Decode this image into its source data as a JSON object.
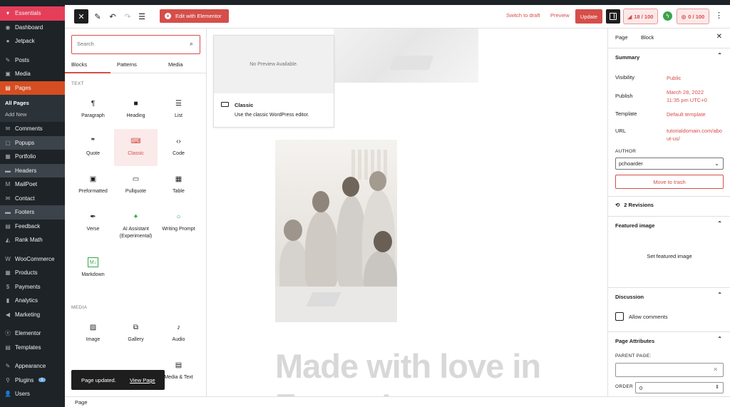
{
  "admin_menu": {
    "items": [
      {
        "label": "Essentials",
        "icon": "filter-icon"
      },
      {
        "label": "Dashboard",
        "icon": "dashboard-icon"
      },
      {
        "label": "Jetpack",
        "icon": "jetpack-icon"
      },
      {
        "label": "Posts",
        "icon": "pin-icon"
      },
      {
        "label": "Media",
        "icon": "media-icon"
      },
      {
        "label": "Pages",
        "icon": "pages-icon"
      },
      {
        "label": "All Pages"
      },
      {
        "label": "Add New"
      },
      {
        "label": "Comments",
        "icon": "comments-icon"
      },
      {
        "label": "Popups",
        "icon": "popups-icon"
      },
      {
        "label": "Portfolio",
        "icon": "portfolio-icon"
      },
      {
        "label": "Headers",
        "icon": "headers-icon"
      },
      {
        "label": "MailPoet",
        "icon": "mailpoet-icon"
      },
      {
        "label": "Contact",
        "icon": "mail-icon"
      },
      {
        "label": "Footers",
        "icon": "footers-icon"
      },
      {
        "label": "Feedback",
        "icon": "feedback-icon"
      },
      {
        "label": "Rank Math",
        "icon": "rankmath-icon"
      },
      {
        "label": "WooCommerce",
        "icon": "woocommerce-icon"
      },
      {
        "label": "Products",
        "icon": "products-icon"
      },
      {
        "label": "Payments",
        "icon": "payments-icon"
      },
      {
        "label": "Analytics",
        "icon": "analytics-icon"
      },
      {
        "label": "Marketing",
        "icon": "megaphone-icon"
      },
      {
        "label": "Elementor",
        "icon": "elementor-icon"
      },
      {
        "label": "Templates",
        "icon": "templates-icon"
      },
      {
        "label": "Appearance",
        "icon": "brush-icon"
      },
      {
        "label": "Plugins",
        "icon": "plugin-icon",
        "badge": "1"
      },
      {
        "label": "Users",
        "icon": "users-icon"
      }
    ]
  },
  "toolbar": {
    "close_icon": "close-icon",
    "edit_elementor": "Edit with Elementor",
    "switch_draft": "Switch to draft",
    "preview": "Preview",
    "update": "Update",
    "seo_score": "18 / 100",
    "readability_score": "0 / 100"
  },
  "inserter": {
    "search_placeholder": "Search",
    "tabs": [
      "Blocks",
      "Patterns",
      "Media"
    ],
    "text_category": "TEXT",
    "media_category": "MEDIA",
    "blocks": [
      {
        "label": "Paragraph",
        "icon": "¶",
        "name": "paragraph-icon"
      },
      {
        "label": "Heading",
        "icon": "🔖",
        "name": "heading-icon"
      },
      {
        "label": "List",
        "icon": "☰",
        "name": "list-icon"
      },
      {
        "label": "Quote",
        "icon": "❞",
        "name": "quote-icon"
      },
      {
        "label": "Classic",
        "icon": "⌨",
        "name": "keyboard-icon"
      },
      {
        "label": "Code",
        "icon": "‹›",
        "name": "code-icon"
      },
      {
        "label": "Preformatted",
        "icon": "▣",
        "name": "preformatted-icon"
      },
      {
        "label": "Pullquote",
        "icon": "▭",
        "name": "pullquote-icon"
      },
      {
        "label": "Table",
        "icon": "▦",
        "name": "table-icon"
      },
      {
        "label": "Verse",
        "icon": "✒",
        "name": "verse-icon"
      },
      {
        "label": "AI Assistant (Experimental)",
        "icon": "✦",
        "name": "ai-sparkle-icon"
      },
      {
        "label": "Writing Prompt",
        "icon": "💡",
        "name": "lightbulb-icon"
      },
      {
        "label": "Markdown",
        "icon": "M↓",
        "name": "markdown-icon"
      }
    ],
    "media_blocks": [
      {
        "label": "Image",
        "icon": "🖼",
        "name": "image-icon"
      },
      {
        "label": "Gallery",
        "icon": "⧉",
        "name": "gallery-icon"
      },
      {
        "label": "Audio",
        "icon": "♪",
        "name": "audio-icon"
      },
      {
        "label": "Media & Text",
        "icon": "▤",
        "name": "media-text-icon"
      }
    ]
  },
  "preview_card": {
    "no_preview": "No Preview Available.",
    "title": "Classic",
    "description": "Use the classic WordPress editor."
  },
  "canvas": {
    "headline": "Made with love in France!"
  },
  "settings": {
    "tabs": [
      "Page",
      "Block"
    ],
    "summary_title": "Summary",
    "visibility_label": "Visibility",
    "visibility_value": "Public",
    "publish_label": "Publish",
    "publish_value": "March 28, 2022 11:35 pm UTC+0",
    "template_label": "Template",
    "template_value": "Default template",
    "url_label": "URL",
    "url_value": "tutorialdomain.com/about-us/",
    "author_label": "AUTHOR",
    "author_value": "pchoarder",
    "move_trash": "Move to trash",
    "revisions": "2 Revisions",
    "featured_title": "Featured image",
    "set_featured": "Set featured image",
    "discussion_title": "Discussion",
    "allow_comments": "Allow comments",
    "attributes_title": "Page Attributes",
    "parent_label": "PARENT PAGE:",
    "order_label": "ORDER",
    "order_value": "0"
  },
  "footer": {
    "breadcrumb": "Page"
  },
  "snackbar": {
    "message": "Page updated.",
    "link": "View Page"
  },
  "colors": {
    "accent": "#d54e4a",
    "admin_bg": "#1d2327",
    "active_menu": "#d54e21"
  }
}
